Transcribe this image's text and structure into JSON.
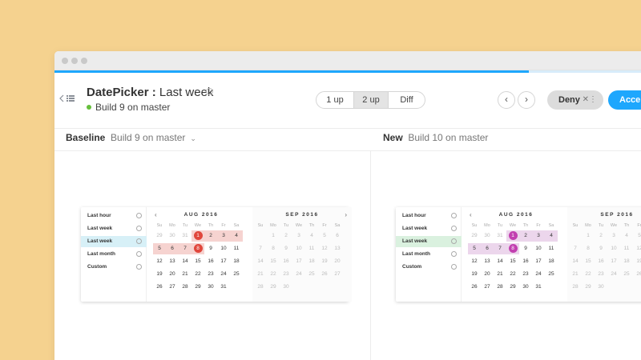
{
  "header": {
    "title_bold": "DatePicker :",
    "title_rest": " Last week",
    "subtitle": "Build 9 on master",
    "status_color": "#66bf3c"
  },
  "toolbar": {
    "view_modes": [
      "1 up",
      "2 up",
      "Diff"
    ],
    "active_view_mode": "2 up",
    "deny_label": "Deny",
    "accept_label": "Accept"
  },
  "progress": {
    "fraction": 0.8
  },
  "columns": {
    "baseline": {
      "label": "Baseline",
      "build": "Build 9 on master"
    },
    "new": {
      "label": "New",
      "build": "Build 10 on master"
    }
  },
  "picker": {
    "presets": [
      "Last hour",
      "Last week",
      "Last week",
      "Last month",
      "Custom"
    ],
    "selected_preset_index": 2,
    "months": [
      {
        "title": "AUG 2016"
      },
      {
        "title": "SEP 2016"
      }
    ],
    "weekdays": [
      "Su",
      "Mo",
      "Tu",
      "We",
      "Th",
      "Fr",
      "Sa"
    ],
    "aug_days": [
      [
        "29",
        "30",
        "31",
        "1",
        "2",
        "3",
        "4"
      ],
      [
        "5",
        "6",
        "7",
        "8",
        "9",
        "10",
        "11"
      ],
      [
        "12",
        "13",
        "14",
        "15",
        "16",
        "17",
        "18"
      ],
      [
        "19",
        "20",
        "21",
        "22",
        "23",
        "24",
        "25"
      ],
      [
        "26",
        "27",
        "28",
        "29",
        "30",
        "31",
        ""
      ]
    ],
    "sep_days": [
      [
        "",
        "1",
        "2",
        "3",
        "4",
        "5",
        "6"
      ],
      [
        "7",
        "8",
        "9",
        "10",
        "11",
        "12",
        "13"
      ],
      [
        "14",
        "15",
        "16",
        "17",
        "18",
        "19",
        "20"
      ],
      [
        "21",
        "22",
        "23",
        "24",
        "25",
        "26",
        "27"
      ],
      [
        "28",
        "29",
        "30",
        "",
        "",
        "",
        ""
      ]
    ]
  },
  "theme": {
    "baseline_range": "#f6d3d0",
    "baseline_endpoint": "#e0473c",
    "baseline_preset_bg": "#d7f0f7",
    "new_range": "#ecd6ec",
    "new_endpoint": "#c23fb0",
    "new_preset_bg": "#daf1df"
  }
}
